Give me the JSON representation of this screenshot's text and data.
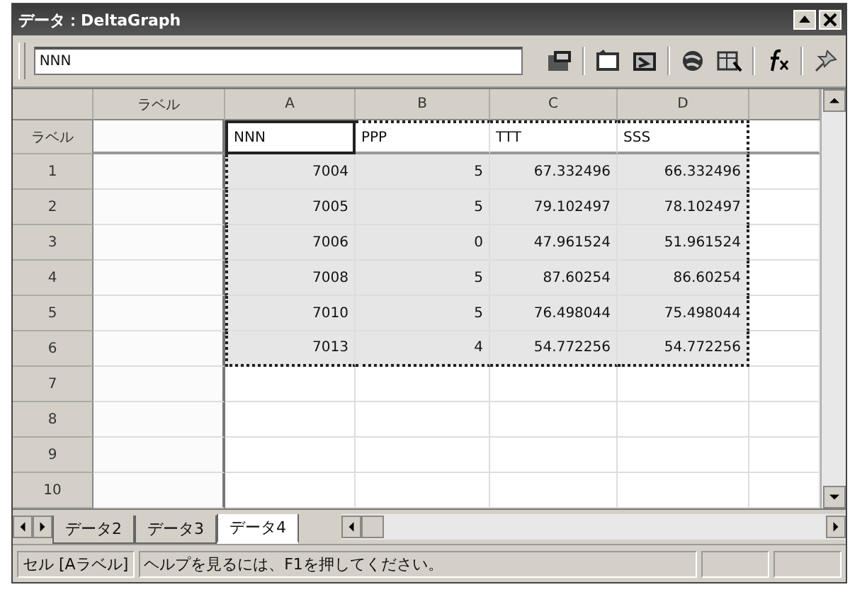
{
  "window": {
    "title": "データ：DeltaGraph"
  },
  "toolbar": {
    "entry_field": {
      "value": "NNN"
    }
  },
  "table": {
    "columns": [
      "ラベル",
      "A",
      "B",
      "C",
      "D"
    ],
    "corner_label": "ラベル",
    "label_row": [
      {
        "active": false,
        "marked": false
      },
      {
        "text": "NNN",
        "active": true,
        "marked": true
      },
      {
        "text": "PPP",
        "active": false,
        "marked": true
      },
      {
        "text": "TTT",
        "active": false,
        "marked": true
      },
      {
        "text": "SSS",
        "active": false,
        "marked": true
      }
    ],
    "rows": [
      {
        "header": "1",
        "cells": [
          {
            "selected": false
          },
          {
            "text": "7004",
            "selected": true
          },
          {
            "text": "5",
            "selected": true
          },
          {
            "text": "67.332496",
            "selected": true
          },
          {
            "text": "66.332496",
            "selected": true
          }
        ]
      },
      {
        "header": "2",
        "cells": [
          {
            "selected": false
          },
          {
            "text": "7005",
            "selected": true
          },
          {
            "text": "5",
            "selected": true
          },
          {
            "text": "79.102497",
            "selected": true
          },
          {
            "text": "78.102497",
            "selected": true
          }
        ]
      },
      {
        "header": "3",
        "cells": [
          {
            "selected": false
          },
          {
            "text": "7006",
            "selected": true
          },
          {
            "text": "0",
            "selected": true
          },
          {
            "text": "47.961524",
            "selected": true
          },
          {
            "text": "51.961524",
            "selected": true
          }
        ]
      },
      {
        "header": "4",
        "cells": [
          {
            "selected": false
          },
          {
            "text": "7008",
            "selected": true
          },
          {
            "text": "5",
            "selected": true
          },
          {
            "text": "87.60254",
            "selected": true
          },
          {
            "text": "86.60254",
            "selected": true
          }
        ]
      },
      {
        "header": "5",
        "cells": [
          {
            "selected": false
          },
          {
            "text": "7010",
            "selected": true
          },
          {
            "text": "5",
            "selected": true
          },
          {
            "text": "76.498044",
            "selected": true
          },
          {
            "text": "75.498044",
            "selected": true
          }
        ]
      },
      {
        "header": "6",
        "cells": [
          {
            "selected": false
          },
          {
            "text": "7013",
            "selected": true
          },
          {
            "text": "4",
            "selected": true
          },
          {
            "text": "54.772256",
            "selected": true
          },
          {
            "text": "54.772256",
            "selected": true
          }
        ]
      },
      {
        "header": "7",
        "cells": [
          {
            "selected": false
          },
          {
            "selected": false
          },
          {
            "selected": false
          },
          {
            "selected": false
          },
          {
            "selected": false
          }
        ]
      },
      {
        "header": "8",
        "cells": [
          {
            "selected": false
          },
          {
            "selected": false
          },
          {
            "selected": false
          },
          {
            "selected": false
          },
          {
            "selected": false
          }
        ]
      },
      {
        "header": "9",
        "cells": [
          {
            "selected": false
          },
          {
            "selected": false
          },
          {
            "selected": false
          },
          {
            "selected": false
          },
          {
            "selected": false
          }
        ]
      },
      {
        "header": "10",
        "cells": [
          {
            "selected": false
          },
          {
            "selected": false
          },
          {
            "selected": false
          },
          {
            "selected": false
          },
          {
            "selected": false
          }
        ]
      }
    ]
  },
  "sheet_tabs": [
    {
      "label": "データ2",
      "selected": false
    },
    {
      "label": "データ3",
      "selected": false
    },
    {
      "label": "データ4",
      "selected": true
    }
  ],
  "status_bar": {
    "cell": "セル [Aラベル]",
    "help": "ヘルプを見るには、F1を押してください。"
  }
}
